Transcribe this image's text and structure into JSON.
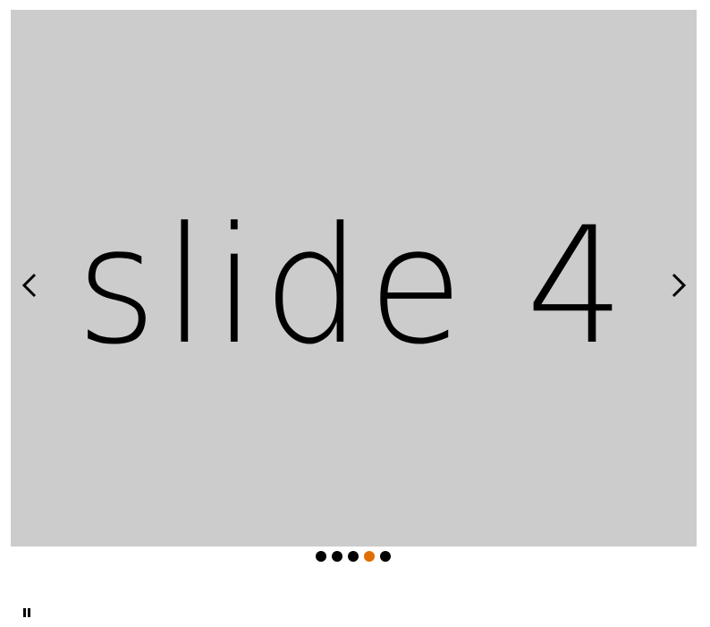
{
  "slide": {
    "text": "slide 4",
    "background": "#cccccc"
  },
  "navigation": {
    "prev_icon": "chevron-left-icon",
    "next_icon": "chevron-right-icon"
  },
  "indicators": {
    "count": 5,
    "active_index": 3,
    "active_color": "#e06e00",
    "inactive_color": "#000000"
  },
  "controls": {
    "pause_icon": "pause-icon"
  }
}
